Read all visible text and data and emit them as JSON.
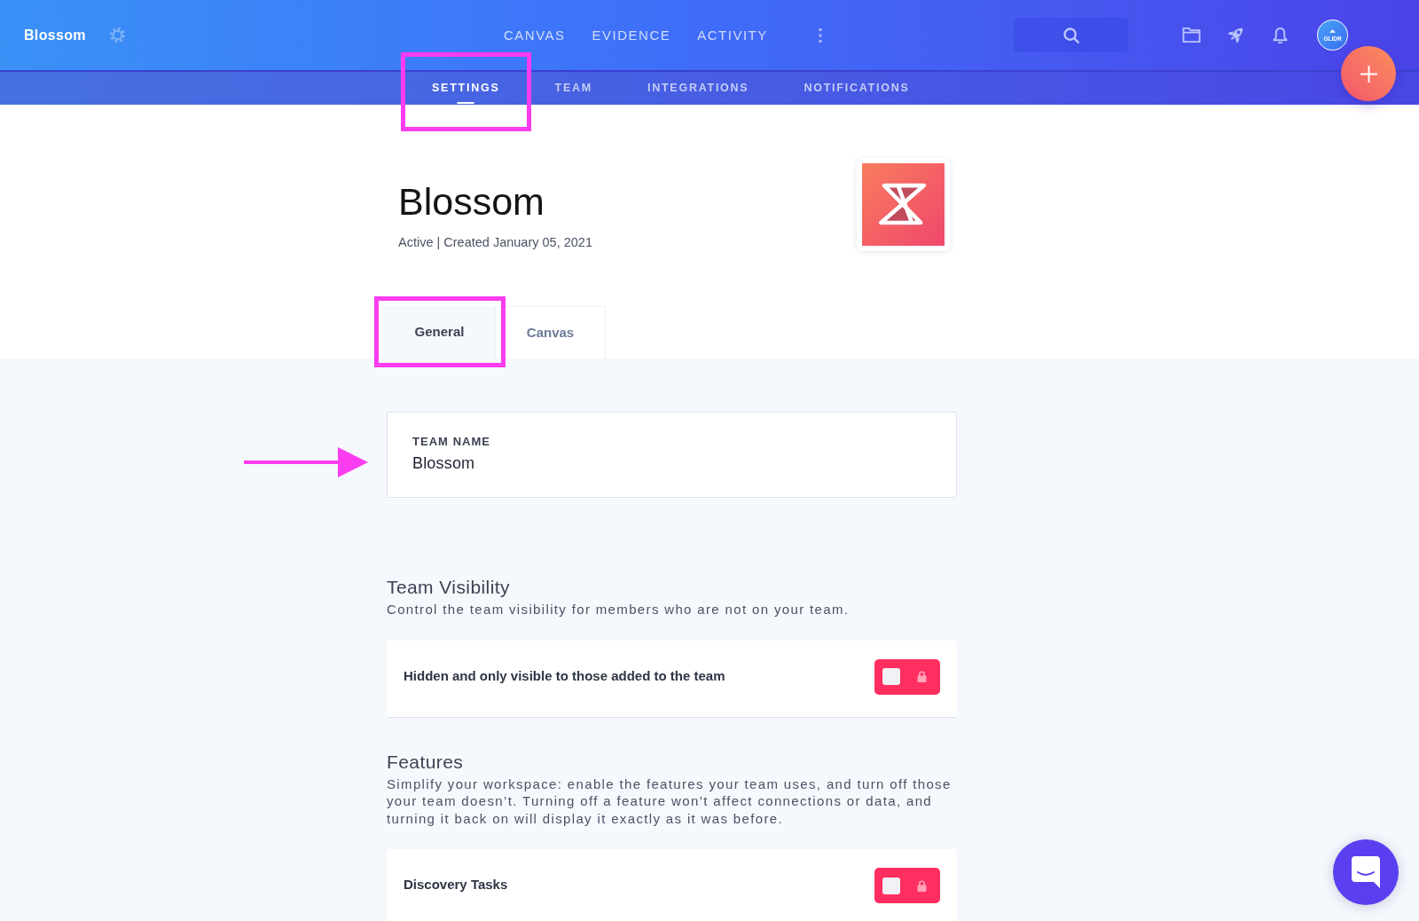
{
  "top_bar": {
    "brand": "Blossom",
    "nav": [
      {
        "label": "CANVAS"
      },
      {
        "label": "EVIDENCE"
      },
      {
        "label": "ACTIVITY"
      }
    ],
    "avatar_label": "GLIDR"
  },
  "sub_nav": [
    {
      "label": "SETTINGS",
      "selected": true,
      "highlighted": true
    },
    {
      "label": "TEAM",
      "selected": false,
      "highlighted": false
    },
    {
      "label": "INTEGRATIONS",
      "selected": false,
      "highlighted": false
    },
    {
      "label": "NOTIFICATIONS",
      "selected": false,
      "highlighted": false
    }
  ],
  "header": {
    "title": "Blossom",
    "subtitle": "Active | Created January 05, 2021"
  },
  "tabs": [
    {
      "label": "General",
      "selected": true,
      "highlighted": true
    },
    {
      "label": "Canvas",
      "selected": false,
      "highlighted": false
    }
  ],
  "team_name": {
    "label": "TEAM NAME",
    "value": "Blossom",
    "pointed_at": true
  },
  "sections": [
    {
      "title": "Team Visibility",
      "description": "Control the team visibility for members who are not on your team.",
      "rows": [
        {
          "label": "Hidden and only visible to those added to the team",
          "on": false,
          "locked": true
        }
      ]
    },
    {
      "title": "Features",
      "description": "Simplify your workspace: enable the features your team uses, and turn off those your team doesn’t. Turning off a feature won’t affect connections or data, and turning it back on will display it exactly as it was before.",
      "rows": [
        {
          "label": "Discovery Tasks",
          "on": false,
          "locked": true
        }
      ]
    }
  ]
}
